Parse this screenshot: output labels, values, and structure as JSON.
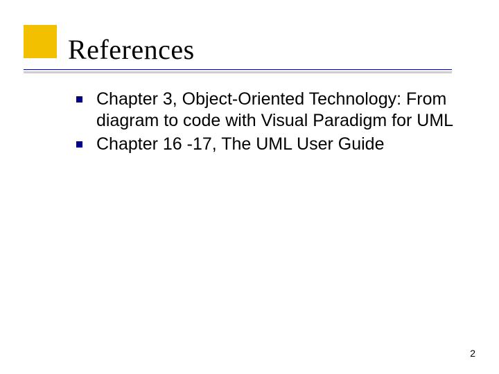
{
  "slide": {
    "title": "References",
    "items": [
      {
        "text": "Chapter 3, Object-Oriented Technology: From diagram to code with Visual Paradigm for UML"
      },
      {
        "text": "Chapter 16 -17, The UML User Guide"
      }
    ],
    "page_number": "2"
  }
}
